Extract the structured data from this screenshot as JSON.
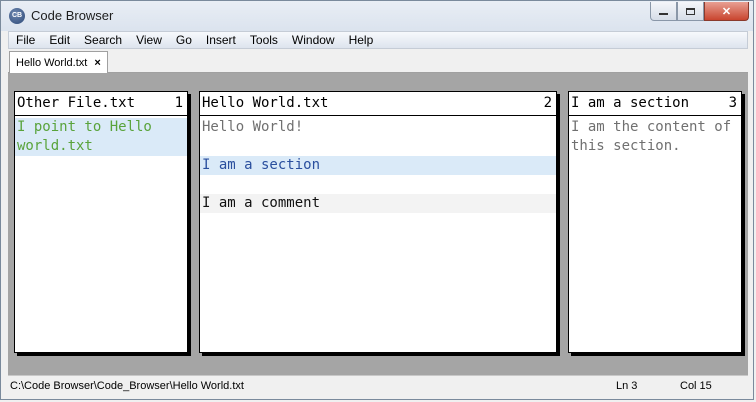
{
  "window": {
    "title": "Code Browser",
    "icon_label": "CB"
  },
  "menu": [
    "File",
    "Edit",
    "Search",
    "View",
    "Go",
    "Insert",
    "Tools",
    "Window",
    "Help"
  ],
  "tab": {
    "label": "Hello World.txt",
    "close_glyph": "×"
  },
  "panes": [
    {
      "title": "Other File.txt",
      "number": "1",
      "blocks": [
        {
          "text": "I point to Hello world.txt",
          "style": "link"
        }
      ]
    },
    {
      "title": "Hello World.txt",
      "number": "2",
      "blocks": [
        {
          "text": "Hello World!",
          "style": "text"
        },
        {
          "text": "I am a section",
          "style": "section"
        },
        {
          "text": "I am a comment",
          "style": "comment"
        }
      ]
    },
    {
      "title": "I am a section",
      "number": "3",
      "blocks": [
        {
          "text": "I am the content of this section.",
          "style": "text"
        }
      ]
    }
  ],
  "status": {
    "path": "C:\\Code Browser\\Code_Browser\\Hello World.txt",
    "line": "Ln 3",
    "col": "Col 15"
  },
  "colors": {
    "link_green": "#59a33b",
    "section_blue": "#2a4f9e",
    "highlight_blue": "#daeaf8",
    "workspace_grey": "#a5a5a5"
  }
}
